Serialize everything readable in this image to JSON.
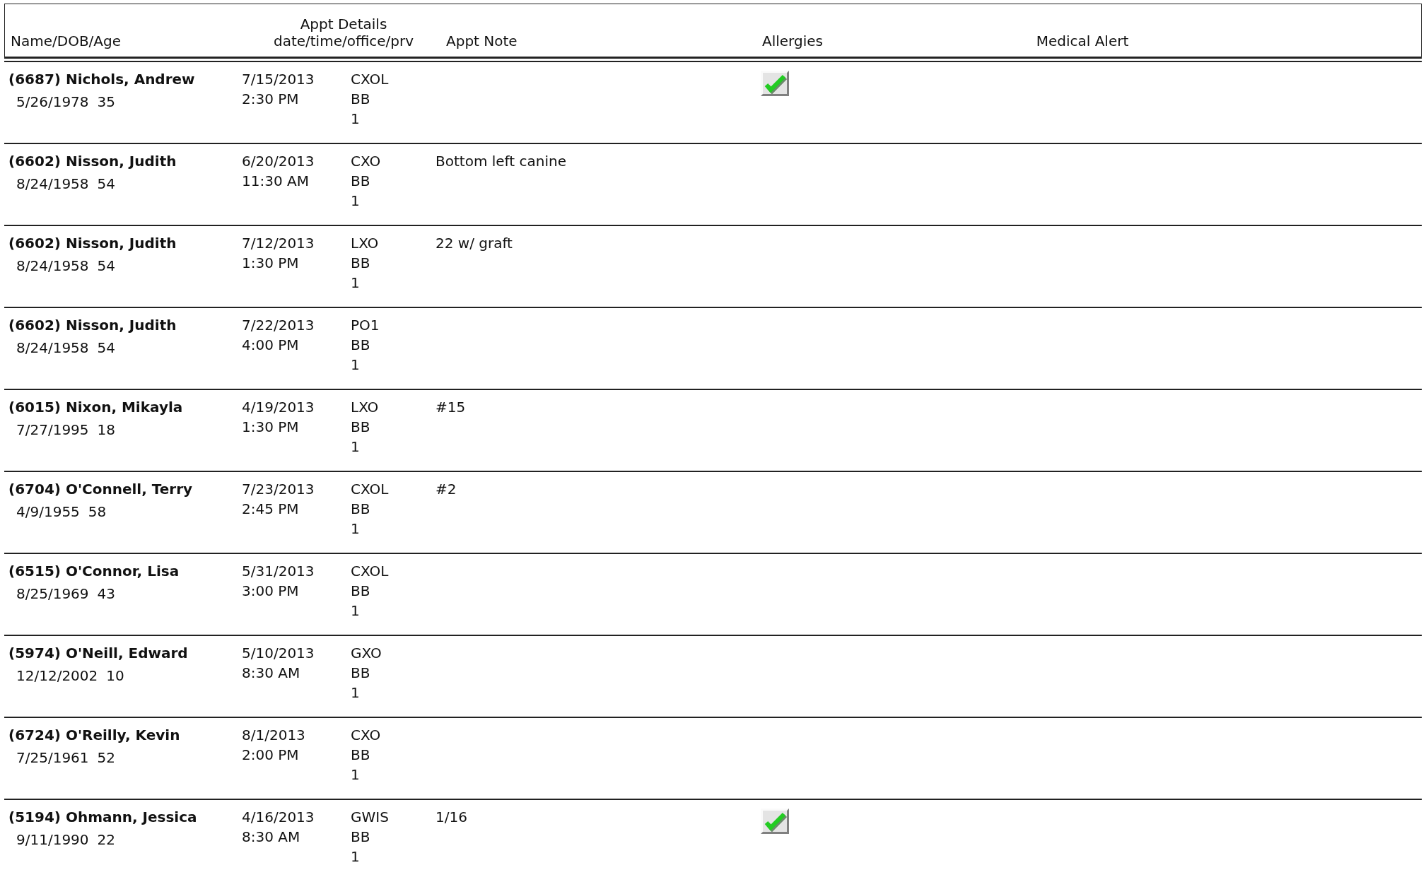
{
  "header": {
    "name": "Name/DOB/Age",
    "appt_details_top": "Appt Details",
    "appt_details": "date/time/office/prv",
    "appt_note": "Appt Note",
    "allergies": "Allergies",
    "medical_alert": "Medical Alert"
  },
  "rows": [
    {
      "name": "(6687) Nichols, Andrew",
      "dob": "5/26/1978",
      "age": "35",
      "date": "7/15/2013",
      "time": "2:30 PM",
      "office": "CXOL",
      "provider": "BB",
      "unit": "1",
      "note": "",
      "allergies": true
    },
    {
      "name": "(6602) Nisson, Judith",
      "dob": "8/24/1958",
      "age": "54",
      "date": "6/20/2013",
      "time": "11:30 AM",
      "office": "CXO",
      "provider": "BB",
      "unit": "1",
      "note": "Bottom left canine",
      "allergies": false
    },
    {
      "name": "(6602) Nisson, Judith",
      "dob": "8/24/1958",
      "age": "54",
      "date": "7/12/2013",
      "time": "1:30 PM",
      "office": "LXO",
      "provider": "BB",
      "unit": "1",
      "note": "22 w/ graft",
      "allergies": false
    },
    {
      "name": "(6602) Nisson, Judith",
      "dob": "8/24/1958",
      "age": "54",
      "date": "7/22/2013",
      "time": "4:00 PM",
      "office": "PO1",
      "provider": "BB",
      "unit": "1",
      "note": "",
      "allergies": false
    },
    {
      "name": "(6015) Nixon, Mikayla",
      "dob": "7/27/1995",
      "age": "18",
      "date": "4/19/2013",
      "time": "1:30 PM",
      "office": "LXO",
      "provider": "BB",
      "unit": "1",
      "note": "#15",
      "allergies": false
    },
    {
      "name": "(6704) O'Connell, Terry",
      "dob": "4/9/1955",
      "age": "58",
      "date": "7/23/2013",
      "time": "2:45 PM",
      "office": "CXOL",
      "provider": "BB",
      "unit": "1",
      "note": "#2",
      "allergies": false
    },
    {
      "name": "(6515) O'Connor, Lisa",
      "dob": "8/25/1969",
      "age": "43",
      "date": "5/31/2013",
      "time": "3:00 PM",
      "office": "CXOL",
      "provider": "BB",
      "unit": "1",
      "note": "",
      "allergies": false
    },
    {
      "name": "(5974) O'Neill, Edward",
      "dob": "12/12/2002",
      "age": "10",
      "date": "5/10/2013",
      "time": "8:30 AM",
      "office": "GXO",
      "provider": "BB",
      "unit": "1",
      "note": "",
      "allergies": false
    },
    {
      "name": "(6724) O'Reilly, Kevin",
      "dob": "7/25/1961",
      "age": "52",
      "date": "8/1/2013",
      "time": "2:00 PM",
      "office": "CXO",
      "provider": "BB",
      "unit": "1",
      "note": "",
      "allergies": false
    },
    {
      "name": "(5194) Ohmann, Jessica",
      "dob": "9/11/1990",
      "age": "22",
      "date": "4/16/2013",
      "time": "8:30 AM",
      "office": "GWIS",
      "provider": "BB",
      "unit": "1",
      "note": "1/16",
      "allergies": true
    }
  ]
}
